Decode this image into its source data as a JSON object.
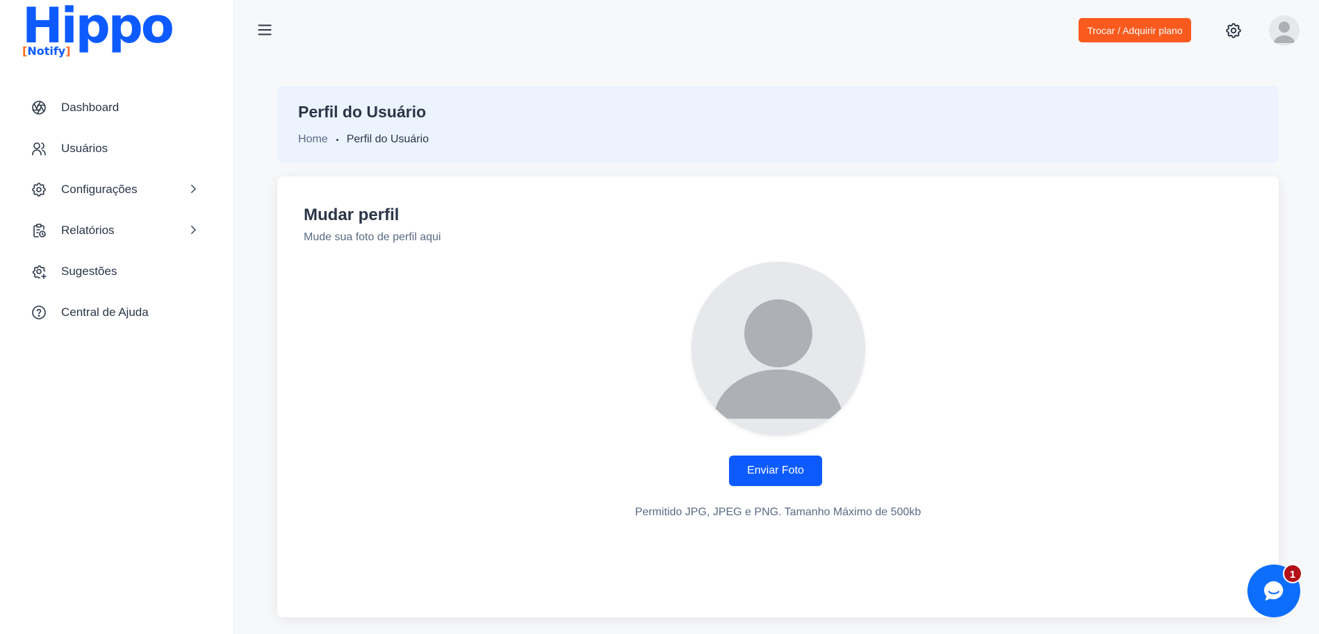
{
  "brand": {
    "name": "Hippo",
    "sub_open": "[",
    "sub": "Notify",
    "sub_close": "]",
    "primary_color": "#0d5bff",
    "accent_color": "#ff6a1f"
  },
  "sidebar": {
    "items": [
      {
        "label": "Dashboard",
        "icon": "aperture-icon",
        "has_chevron": false
      },
      {
        "label": "Usuários",
        "icon": "users-icon",
        "has_chevron": false
      },
      {
        "label": "Configurações",
        "icon": "gear-icon",
        "has_chevron": true
      },
      {
        "label": "Relatórios",
        "icon": "clipboard-clock-icon",
        "has_chevron": true
      },
      {
        "label": "Sugestões",
        "icon": "gear-plus-icon",
        "has_chevron": false
      },
      {
        "label": "Central de Ajuda",
        "icon": "help-circle-icon",
        "has_chevron": false
      }
    ]
  },
  "topbar": {
    "plan_button": "Trocar / Adquirir plano",
    "plan_color": "#fa5a1e"
  },
  "header": {
    "title": "Perfil do Usuário",
    "breadcrumb_home": "Home",
    "breadcrumb_current": "Perfil do Usuário"
  },
  "card": {
    "title": "Mudar perfil",
    "subtitle": "Mude sua foto de perfil aqui",
    "upload_button": "Enviar Foto",
    "hint": "Permitido JPG, JPEG e PNG. Tamanho Máximo de 500kb"
  },
  "chat": {
    "badge_count": "1"
  }
}
